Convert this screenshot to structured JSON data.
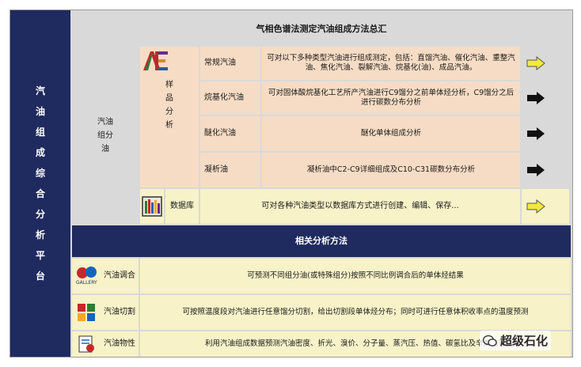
{
  "platform_title": "汽油组成综合分析平台",
  "main_title": "气相色谱法测定汽油组成方法总汇",
  "gasoline_group": "汽油组分油",
  "sample_analysis": "样品分析",
  "methods": [
    {
      "name": "常规汽油",
      "desc": "可对以下多种类型汽油进行组成测定，包括：直馏汽油、催化汽油、重整汽油、焦化汽油、裂解汽油、烷基化(油)、成品汽油。",
      "arrow": "yellow"
    },
    {
      "name": "烷基化汽油",
      "desc": "可对固体酸烷基化工艺所产汽油进行C9馏分之前单体烃分析，C9馏分之后进行碳数分布分析",
      "arrow": "black"
    },
    {
      "name": "醚化汽油",
      "desc": "醚化单体组成分析",
      "arrow": "black"
    },
    {
      "name": "凝析油",
      "desc": "凝析油中C2-C9详细组成及C10-C31碳数分布分析",
      "arrow": "black"
    }
  ],
  "database": {
    "name": "数据库",
    "desc": "可对各种汽油类型以数据库方式进行创建、编辑、保存...",
    "arrow": "yellow"
  },
  "related_header": "相关分析方法",
  "related": [
    {
      "name": "汽油调合",
      "desc": "可预测不同组分油(或特殊组分)按照不同比例调合后的单体烃结果",
      "icon": "gallery-icon",
      "icon_label": "GALLERY"
    },
    {
      "name": "汽油切割",
      "desc": "可按照温度段对汽油进行任意馏分切割，给出切割段单体烃分布；同时可进行任意体积收率点的温度预测",
      "icon": "cut-icon"
    },
    {
      "name": "汽油物性",
      "desc": "利用汽油组成数据预测汽油密度、折光、溴价、分子量、蒸汽压、热值、碳氢比及辛烷值等",
      "icon": "property-icon"
    }
  ],
  "watermark": "超级石化",
  "colors": {
    "navy": "#1f2a5e",
    "peach": "#f6dcc4",
    "cream": "#f7f2c8",
    "gray": "#d9d9d9",
    "arrow_yellow": "#f2ea3a"
  }
}
